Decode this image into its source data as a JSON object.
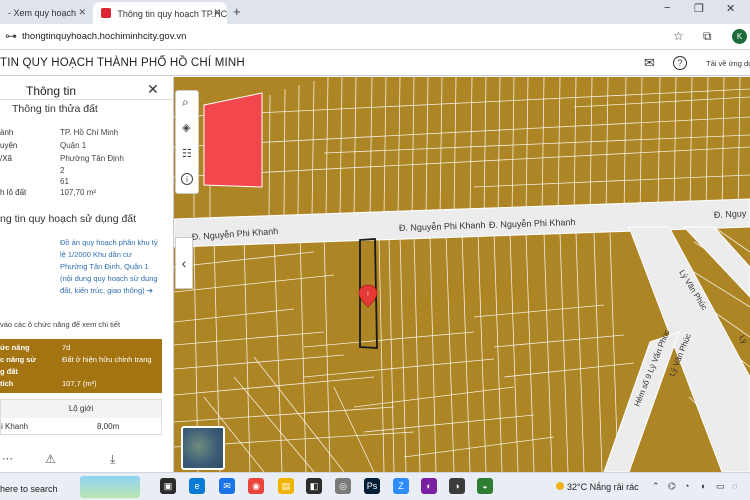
{
  "browser": {
    "tabs": [
      {
        "label": "- Xem quy hoạch"
      },
      {
        "label": "Thông tin quy hoạch TP.HCM"
      }
    ],
    "new_tab": "+",
    "url": "thongtinquyhoach.hochiminhcity.gov.vn",
    "avatar": "K",
    "window_controls": [
      "−",
      "❐",
      "✕"
    ]
  },
  "app": {
    "title": "TIN QUY HOẠCH THÀNH PHỐ HỒ CHÍ MINH",
    "help_link": "Tải về ứng dụ"
  },
  "panel": {
    "title": "Thông tin",
    "section1": "Thông tin thửa đất",
    "parcel_rows": [
      {
        "label": "ành",
        "value": "TP. Hồ Chí Minh"
      },
      {
        "label": "uyện",
        "value": "Quận 1"
      },
      {
        "label": "/Xã",
        "value": "Phường Tân Định"
      },
      {
        "label": "",
        "value": "2"
      },
      {
        "label": "",
        "value": "61"
      },
      {
        "label": "h lô đất",
        "value": "107,70 m²"
      }
    ],
    "section2": "ng tin quy hoạch sử dụng đất",
    "plan_link": "Đồ án quy hoạch phân khu tỷ lệ 1/2000 Khu dân cư Phường Tân Định, Quận 1 (nội dung quy hoạch sử dụng đất, kiến trúc, giao thông) ➜",
    "note": "vào các ô chức năng để xem chi tiết",
    "function_rows": [
      {
        "label": "ức năng",
        "value": "7d"
      },
      {
        "label": "c năng sử",
        "value": "Đất ở hiện hữu chỉnh trang"
      },
      {
        "label": "g đất",
        "value": ""
      },
      {
        "label": "tích",
        "value": "107,7 (m²)"
      }
    ],
    "boundary": {
      "header": "Lộ giới",
      "street": "i Khanh",
      "width": "8,00m"
    }
  },
  "map": {
    "streets": {
      "a": "Đ. Nguyễn Phi Khanh",
      "b": "Đ. Nguyễn Phi Khanh",
      "c": "Đ. Nguyễn Phi Khanh",
      "d": "Đ. Nguy",
      "e": "Lý Văn Phúc",
      "f": "Lý Văn Phúc",
      "g": "Hẻm số 9 Lý Văn Phúc",
      "h": "Lý"
    },
    "collapse": "‹"
  },
  "taskbar": {
    "search": "here to search",
    "weather": "32°C  Nắng rải rác"
  },
  "colors": {
    "residential": "#ad8524",
    "highlight": "#f2484d",
    "panel_box": "#a47411",
    "road": "#ececec"
  }
}
